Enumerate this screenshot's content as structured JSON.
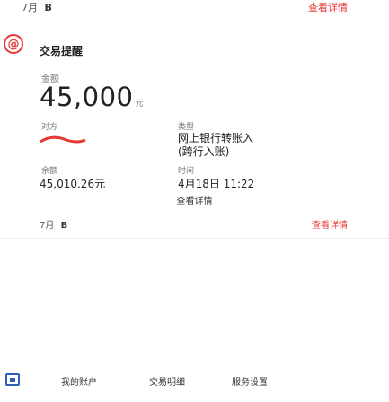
{
  "top": {
    "time": "7月",
    "bold_mark": "B",
    "link": "查看详情"
  },
  "card": {
    "title": "交易提醒",
    "amount_label": "金额",
    "amount": "45,000",
    "amount_unit": "元",
    "counter_label": "对方",
    "counter_brand": "brand-logo",
    "type_label": "类型",
    "type_line1": "网上银行转账入",
    "type_line2": "(跨行入账)",
    "balance_label": "余额",
    "balance": "45,010.26元",
    "time_label": "时间",
    "time": "4月18日 11:22",
    "detail_link": "查看详情"
  },
  "second": {
    "time": "7月",
    "bold_mark": "B",
    "link": "查看详情"
  },
  "bottom_tabs": [
    "我的账户",
    "交易明细",
    "服务设置"
  ],
  "colors": {
    "accent": "#e53935",
    "blue": "#2f5fb4"
  }
}
